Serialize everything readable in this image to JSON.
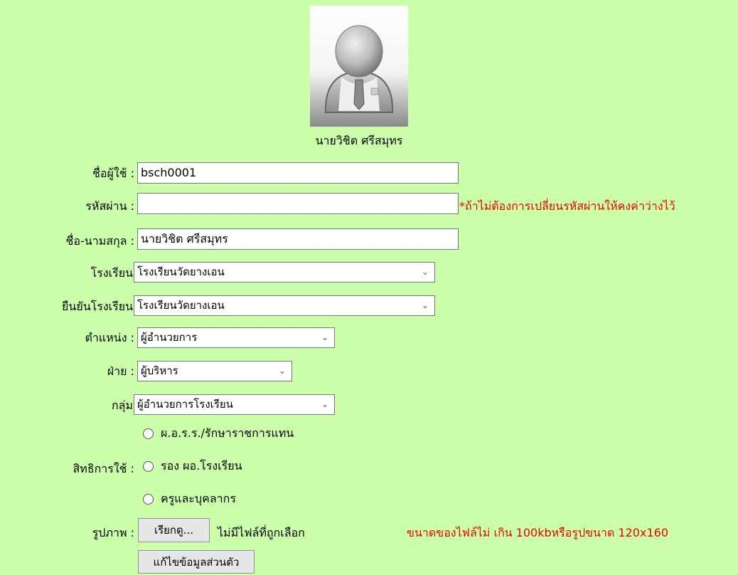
{
  "profile": {
    "avatar_icon": "user-avatar-icon",
    "display_name": "นายวิชิต ศรีสมุทร"
  },
  "form": {
    "username": {
      "label": "ชื่อผู้ใช้ :",
      "value": "bsch0001"
    },
    "password": {
      "label": "รหัสผ่าน :",
      "value": "",
      "hint": "*ถ้าไม่ต้องการเปลี่ยนรหัสผ่านให้คงค่าว่างไว้"
    },
    "fullname": {
      "label": "ชื่อ-นามสกุล :",
      "value": "นายวิชิต  ศรีสมุทร"
    },
    "school": {
      "label": "โรงเรียน",
      "selected": "โรงเรียนวัดยางเอน"
    },
    "confirm_school": {
      "label": "ยืนยันโรงเรียน",
      "selected": "โรงเรียนวัดยางเอน"
    },
    "position": {
      "label": "ตำแหน่ง :",
      "selected": "ผู้อำนวยการ"
    },
    "department": {
      "label": "ฝ่าย :",
      "selected": "ผู้บริหาร"
    },
    "group": {
      "label": "กลุ่ม",
      "selected": "ผู้อำนวยการโรงเรียน"
    },
    "permission": {
      "label": "สิทธิการใช้ :",
      "options": [
        "ผ.อ.ร.ร./รักษาราชการแทน",
        "รอง ผอ.โรงเรียน",
        "ครูและบุคลากร"
      ]
    },
    "photo": {
      "label": "รูปภาพ :",
      "browse_label": "เรียกดู...",
      "no_file_text": "ไม่มีไฟล์ที่ถูกเลือก",
      "hint": "ขนาดของไฟล์ไม่ เกิน 100kbหรือรูปขนาด 120x160"
    },
    "submit_label": "แก้ไขข้อมูลส่วนตัว"
  }
}
